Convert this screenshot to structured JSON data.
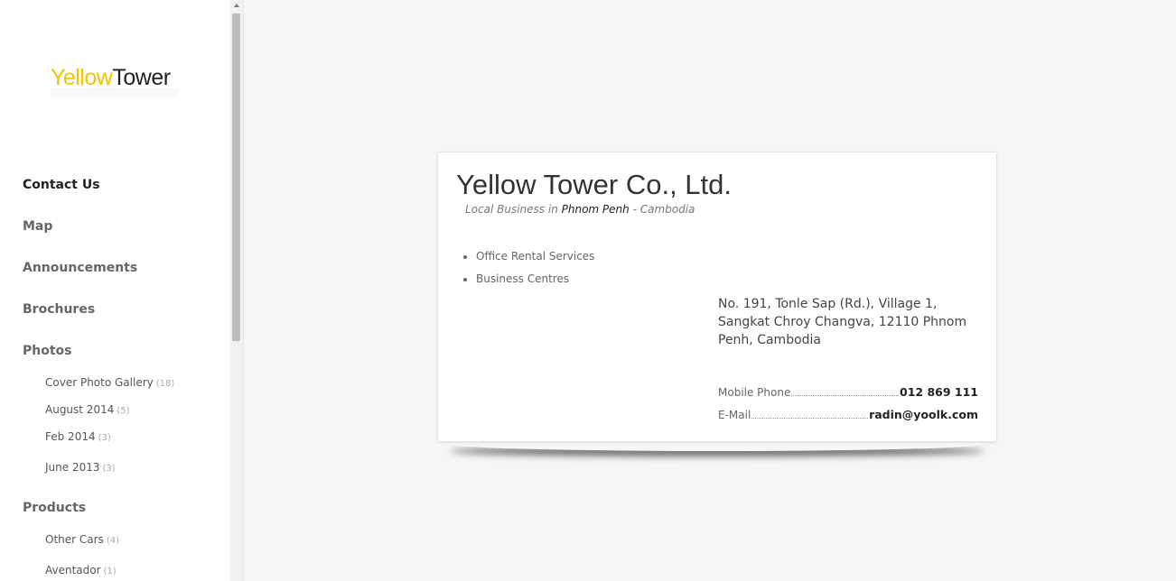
{
  "sidebar": {
    "logo": {
      "part1": "Yellow",
      "part2": "Tower"
    },
    "nav": {
      "contact": "Contact Us",
      "map": "Map",
      "announcements": "Announcements",
      "brochures": "Brochures",
      "photos": "Photos",
      "products": "Products"
    },
    "photo_albums": [
      {
        "label": "Cover Photo Gallery",
        "count": "(18)"
      },
      {
        "label": "August 2014",
        "count": "(5)"
      },
      {
        "label": "Feb 2014",
        "count": "(3)"
      },
      {
        "label": "June 2013",
        "count": "(3)"
      }
    ],
    "product_items": [
      {
        "label": "Other Cars",
        "count": "(4)"
      },
      {
        "label": "Aventador",
        "count": "(1)"
      }
    ]
  },
  "card": {
    "company_name": "Yellow Tower Co., Ltd.",
    "category": "Local Business in",
    "city": "Phnom Penh",
    "country": "- Cambodia",
    "services": [
      "Office Rental Services",
      "Business Centres"
    ],
    "address": "No. 191, Tonle Sap (Rd.), Village 1, Sangkat Chroy Changva, 12110 Phnom Penh, Cambodia",
    "mobile_label": "Mobile Phone",
    "mobile_value": "012 869 111",
    "email_label": "E-Mail",
    "email_value": "radin@yoolk.com"
  },
  "colors": {
    "logo_yellow": "#f2c400",
    "background": "#f6f6f6"
  }
}
